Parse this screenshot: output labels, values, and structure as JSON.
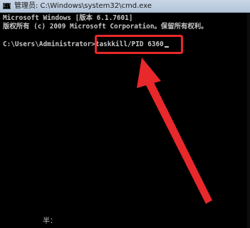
{
  "window": {
    "title": "管理员: C:\\Windows\\system32\\cmd.exe",
    "icon": "cmd-icon"
  },
  "console": {
    "lines": [
      "Microsoft Windows [版本 6.1.7601]",
      "版权所有 (c) 2009 Microsoft Corporation。保留所有权利。",
      "",
      "C:\\Users\\Administrator>taskkill/PID 6360"
    ],
    "ime_status": "半："
  },
  "annotation": {
    "color": "#e8282a",
    "highlighted_command": "taskkill/PID 6360"
  }
}
